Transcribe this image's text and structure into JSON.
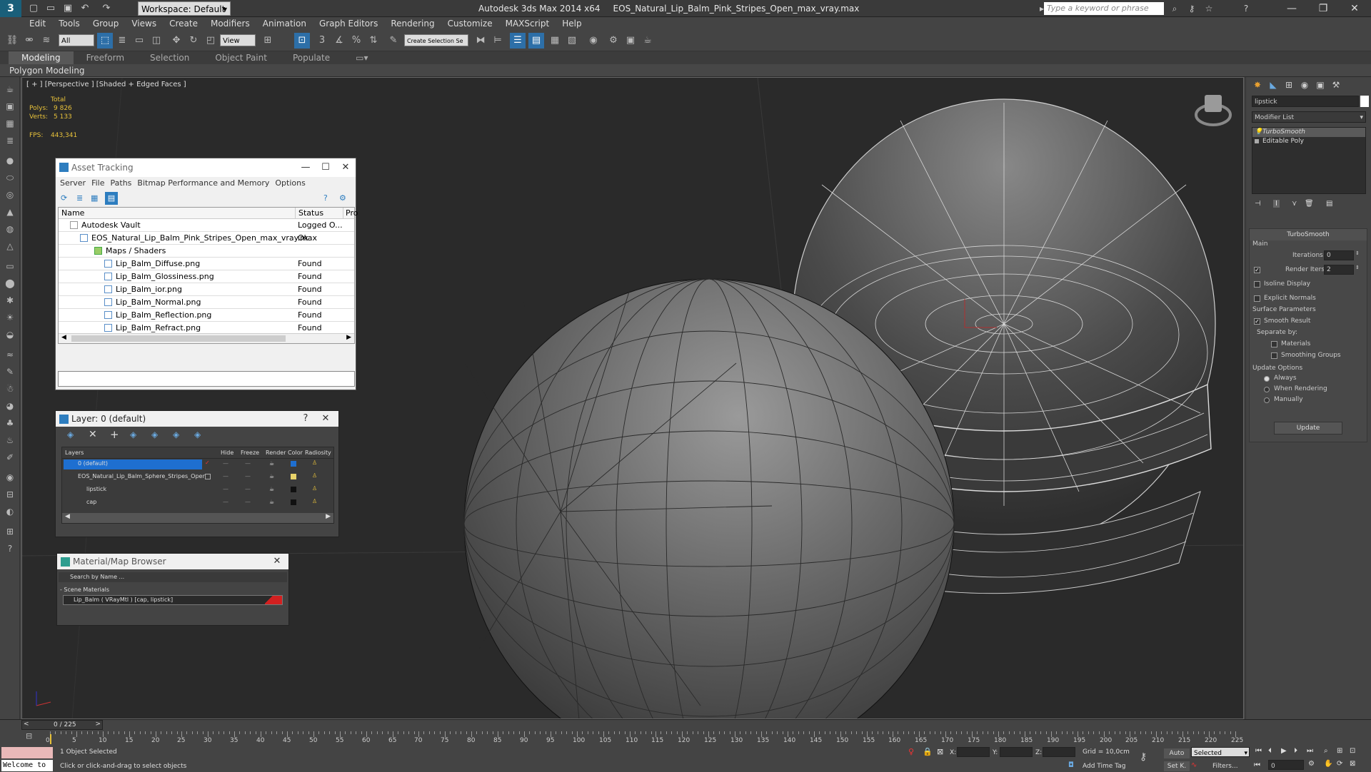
{
  "titlebar": {
    "workspace": "Workspace: Default",
    "app_name": "Autodesk 3ds Max  2014 x64",
    "file_name": "EOS_Natural_Lip_Balm_Pink_Stripes_Open_max_vray.max",
    "search_placeholder": "Type a keyword or phrase"
  },
  "menu": [
    "Edit",
    "Tools",
    "Group",
    "Views",
    "Create",
    "Modifiers",
    "Animation",
    "Graph Editors",
    "Rendering",
    "Customize",
    "MAXScript",
    "Help"
  ],
  "toolbar": {
    "filter": "All",
    "view": "View",
    "selection_set": "Create Selection Se"
  },
  "ribbon": {
    "tabs": [
      "Modeling",
      "Freeform",
      "Selection",
      "Object Paint",
      "Populate"
    ],
    "sub": "Polygon Modeling"
  },
  "viewport": {
    "label": "[ + ] [Perspective ] [Shaded + Edged Faces ]",
    "stats_total": "Total",
    "polys_label": "Polys:",
    "polys": "9 826",
    "verts_label": "Verts:",
    "verts": "5 133",
    "fps_label": "FPS:",
    "fps": "443,341"
  },
  "asset_tracking": {
    "title": "Asset Tracking",
    "menu": [
      "Server",
      "File",
      "Paths",
      "Bitmap Performance and Memory",
      "Options"
    ],
    "col_name": "Name",
    "col_status": "Status",
    "col_pro": "Pro",
    "rows": [
      {
        "name": "Autodesk Vault",
        "status": "Logged O..."
      },
      {
        "name": "EOS_Natural_Lip_Balm_Pink_Stripes_Open_max_vray.max",
        "status": "Ok"
      },
      {
        "name": "Maps / Shaders",
        "status": ""
      },
      {
        "name": "Lip_Balm_Diffuse.png",
        "status": "Found"
      },
      {
        "name": "Lip_Balm_Glossiness.png",
        "status": "Found"
      },
      {
        "name": "Lip_Balm_ior.png",
        "status": "Found"
      },
      {
        "name": "Lip_Balm_Normal.png",
        "status": "Found"
      },
      {
        "name": "Lip_Balm_Reflection.png",
        "status": "Found"
      },
      {
        "name": "Lip_Balm_Refract.png",
        "status": "Found"
      }
    ]
  },
  "layer_dialog": {
    "title": "Layer: 0 (default)",
    "help": "?",
    "cols": [
      "Layers",
      "Hide",
      "Freeze",
      "Render",
      "Color",
      "Radiosity"
    ],
    "rows": [
      {
        "name": "0 (default)"
      },
      {
        "name": "EOS_Natural_Lip_Balm_Sphere_Stripes_Open"
      },
      {
        "name": "lipstick"
      },
      {
        "name": "cap"
      }
    ]
  },
  "material_browser": {
    "title": "Material/Map Browser",
    "search": "Search by Name ...",
    "section": "- Scene Materials",
    "item": "Lip_Balm  ( VRayMtl ) [cap, lipstick]"
  },
  "command_panel": {
    "object_name": "lipstick",
    "modifier_list": "Modifier List",
    "stack": [
      "TurboSmooth",
      "Editable Poly"
    ],
    "turbosmooth": {
      "title": "TurboSmooth",
      "main": "Main",
      "iterations_label": "Iterations:",
      "iterations": "0",
      "render_iters_label": "Render Iters:",
      "render_iters": "2",
      "isoline": "Isoline Display",
      "explicit": "Explicit Normals",
      "surface": "Surface Parameters",
      "smooth_result": "Smooth Result",
      "separate_by": "Separate by:",
      "materials": "Materials",
      "smoothing_groups": "Smoothing Groups",
      "update_options": "Update Options",
      "always": "Always",
      "when_rendering": "When Rendering",
      "manually": "Manually",
      "update_btn": "Update"
    }
  },
  "timeline": {
    "frame": "0 / 225",
    "ticks": [
      "0",
      "5",
      "10",
      "15",
      "20",
      "25",
      "30",
      "35",
      "40",
      "45",
      "50",
      "55",
      "60",
      "65",
      "70",
      "75",
      "80",
      "85",
      "90",
      "95",
      "100",
      "105",
      "110",
      "115",
      "120",
      "125",
      "130",
      "135",
      "140",
      "145",
      "150",
      "155",
      "160",
      "165",
      "170",
      "175",
      "180",
      "185",
      "190",
      "195",
      "200",
      "205",
      "210",
      "215",
      "220",
      "225"
    ]
  },
  "status": {
    "welcome": "Welcome to",
    "selected": "1 Object Selected",
    "hint": "Click or click-and-drag to select objects",
    "x": "X:",
    "y": "Y:",
    "z": "Z:",
    "grid": "Grid = 10,0cm",
    "add_time_tag": "Add Time Tag",
    "auto": "Auto",
    "selected_mode": "Selected",
    "setk": "Set K.",
    "filters": "Filters...",
    "frame_field": "0"
  }
}
